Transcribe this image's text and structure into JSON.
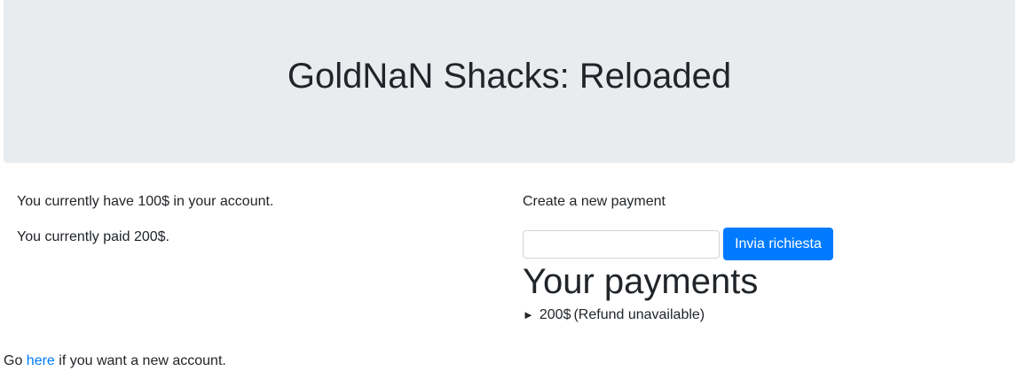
{
  "header": {
    "title": "GoldNaN Shacks: Reloaded"
  },
  "account": {
    "balance_text": "You currently have 100$ in your account.",
    "paid_text": "You currently paid 200$."
  },
  "payment_form": {
    "label": "Create a new payment",
    "input_value": "",
    "submit_label": "Invia richiesta"
  },
  "payments": {
    "title": "Your payments",
    "items": [
      {
        "marker": "►",
        "amount": "200$",
        "status": "(Refund unavailable)"
      }
    ]
  },
  "footer": {
    "prefix": "Go ",
    "link_text": "here",
    "suffix": " if you want a new account."
  },
  "colors": {
    "jumbotron_bg": "#e9ecef",
    "primary": "#007bff",
    "text": "#212529"
  }
}
